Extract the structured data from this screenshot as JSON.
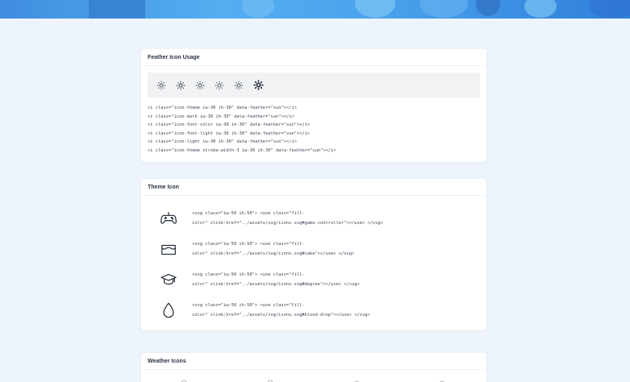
{
  "colors": {
    "page_bg": "#edf4fb",
    "banner": "#4aa2ec",
    "card_bg": "#ffffff",
    "icon_strip_bg": "#f1f2f4"
  },
  "feather_card": {
    "title": "Feather Icon Usage",
    "icons": [
      "sun-icon",
      "sun-icon",
      "sun-icon",
      "sun-icon",
      "sun-icon",
      "sun-icon-bold"
    ],
    "code_lines": [
      "<i class=\"icon-theme iw-30 ih-30\" data-feather=\"sun\"></i>",
      "<i class=\"icon-dark iw-30 ih-30\" data-feather=\"sun\"></i>",
      "<i class=\"icon-font-color iw-30 ih-30\" data-feather=\"sun\"></i>",
      "<i class=\"icon-font-light iw-30 ih-30\" data-feather=\"sun\"></i>",
      "<i class=\"icon-light iw-30 ih-30\" data-feather=\"sun\"></i>",
      "<i class=\"icon-theme stroke-width-3 iw-30 ih-30\" data-feather=\"sun\"></i>"
    ]
  },
  "theme_card": {
    "title": "Theme Icon",
    "rows": [
      {
        "icon": "game-controller-icon",
        "code_a": "<svg class=\"iw-50 ih-50\"> <use class=\"fill-",
        "code_b": "color\" xlink:href=\"../assets/svg/icons.svg#game-controller\"></use> </svg>"
      },
      {
        "icon": "cake-icon",
        "code_a": "<svg class=\"iw-50 ih-50\"> <use class=\"fill-",
        "code_b": "color\" xlink:href=\"../assets/svg/icons.svg#cake\"></use> </svg>"
      },
      {
        "icon": "degree-icon",
        "code_a": "<svg class=\"iw-50 ih-50\"> <use class=\"fill-",
        "code_b": "color\" xlink:href=\"../assets/svg/icons.svg#degree\"></use> </svg>"
      },
      {
        "icon": "blood-drop-icon",
        "code_a": "<svg class=\"iw-50 ih-50\"> <use class=\"fill-",
        "code_b": "color\" xlink:href=\"../assets/svg/icons.svg#blood-drop\"></use> </svg>"
      }
    ]
  },
  "weather_card": {
    "title": "Weather Icons"
  }
}
